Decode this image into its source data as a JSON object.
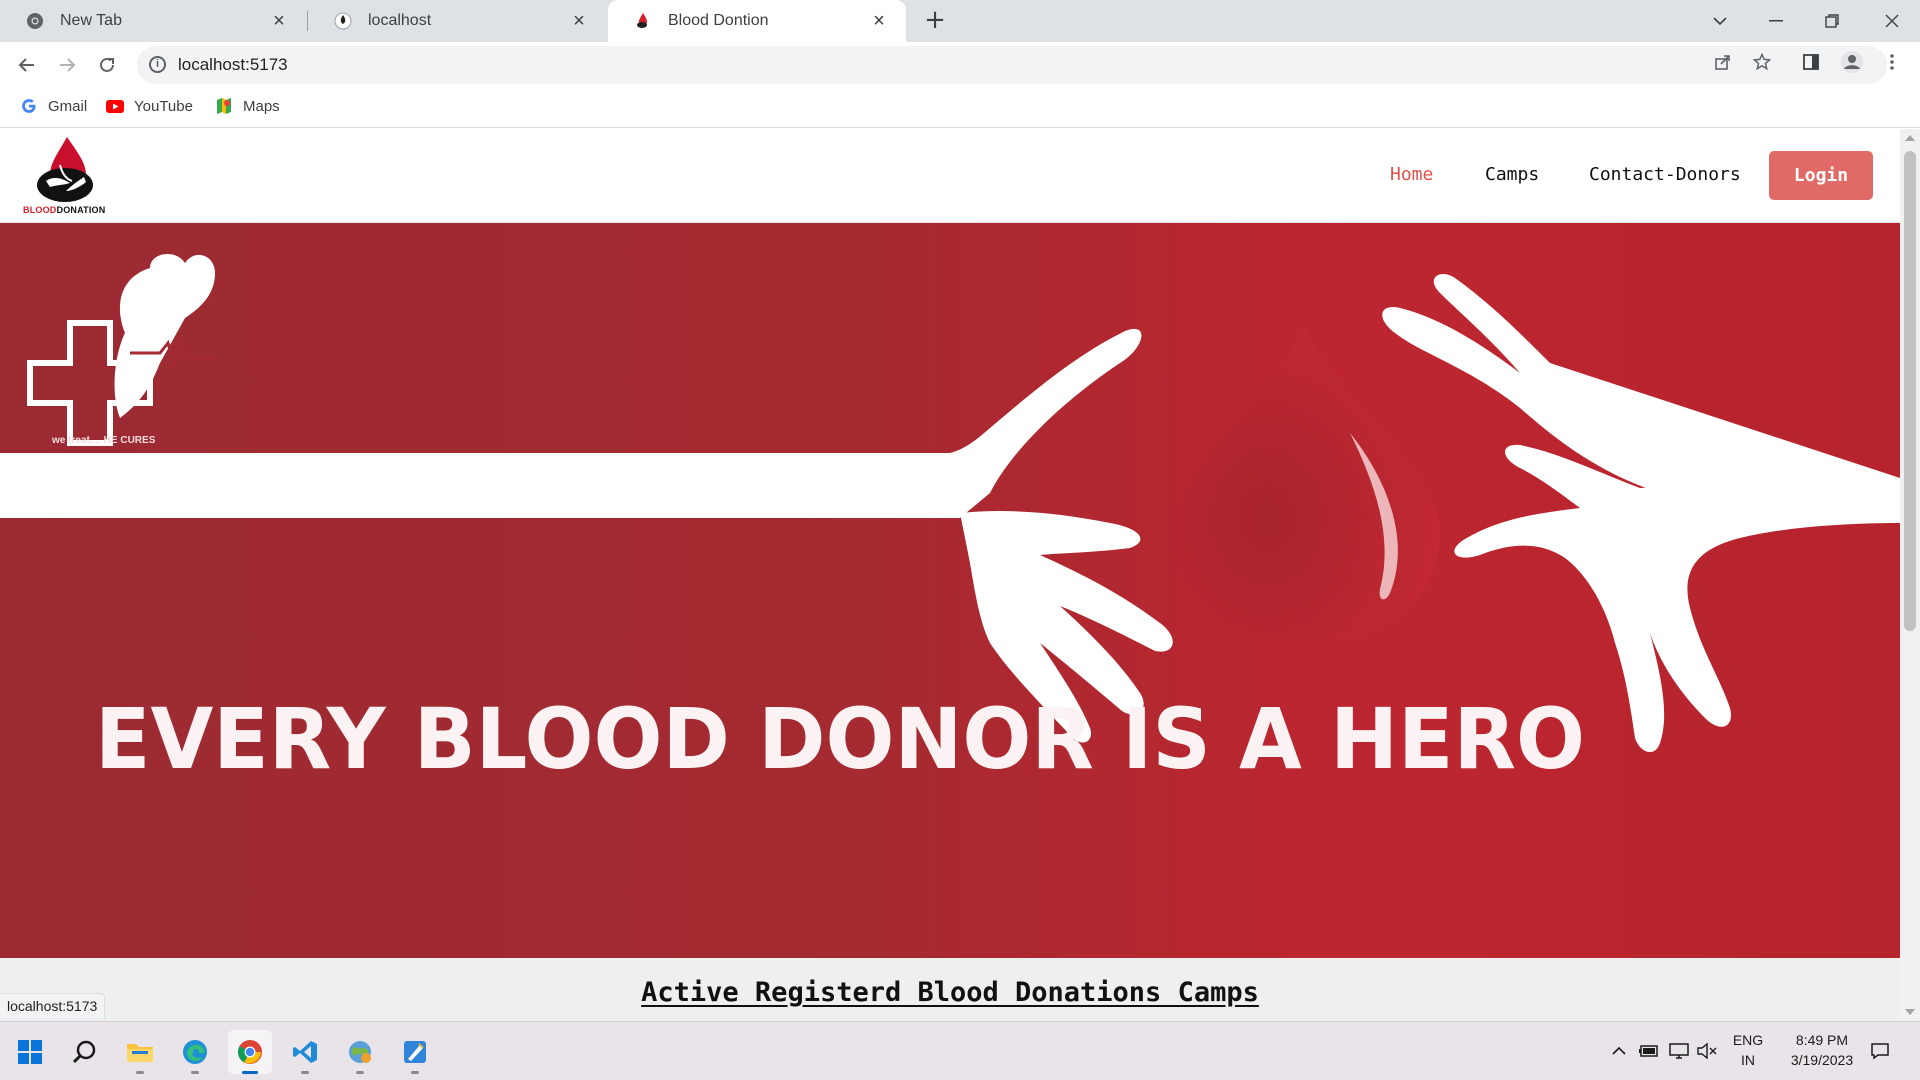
{
  "browser": {
    "tabs": [
      {
        "title": "New Tab",
        "active": false
      },
      {
        "title": "localhost",
        "active": false
      },
      {
        "title": "Blood Dontion",
        "active": true
      }
    ],
    "url": "localhost:5173",
    "bookmarks": [
      {
        "label": "Gmail",
        "icon": "google-icon"
      },
      {
        "label": "YouTube",
        "icon": "youtube-icon"
      },
      {
        "label": "Maps",
        "icon": "maps-icon"
      }
    ],
    "status_url": "localhost:5173"
  },
  "site": {
    "logo": {
      "word1": "BLOOD",
      "word2": "DONATION"
    },
    "nav": {
      "home": "Home",
      "camps": "Camps",
      "contact": "Contact-Donors",
      "login": "Login"
    },
    "hero": {
      "headline": "EVERY BLOOD DONOR IS A HERO",
      "tagline": "we treat.... HE CURES"
    },
    "section_title": "Active Registerd Blood Donations Camps"
  },
  "taskbar": {
    "apps": [
      "start-icon",
      "search-icon",
      "file-explorer-icon",
      "edge-icon",
      "chrome-icon",
      "vscode-icon",
      "network-app-icon",
      "paint-icon"
    ],
    "language": "ENG",
    "region": "IN",
    "time": "8:49 PM",
    "date": "3/19/2023"
  },
  "colors": {
    "brand_red": "#d2232a",
    "nav_active": "#e0514a",
    "login_bg": "#e06b66",
    "hero_red": "#b3242c"
  }
}
